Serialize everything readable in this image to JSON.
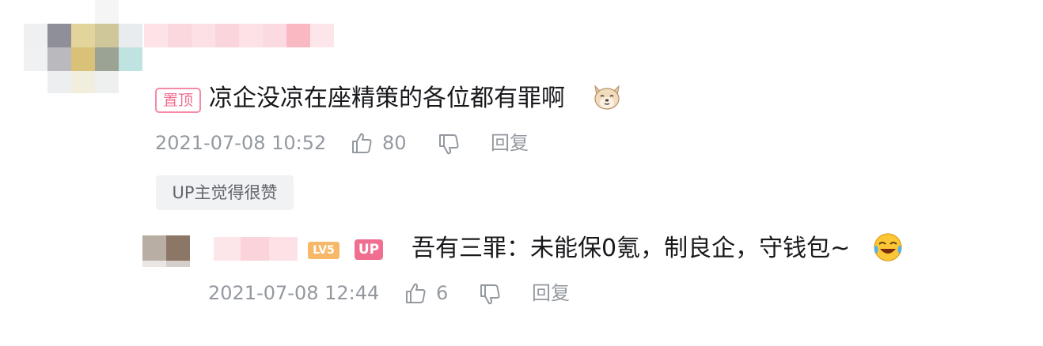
{
  "comment": {
    "pin_label": "置顶",
    "text": "凉企没凉在座精策的各位都有罪啊",
    "emoji_icon": "dog-face-emoji",
    "timestamp": "2021-07-08 10:52",
    "like_count": "80",
    "reply_label": "回复",
    "up_liked_tag": "UP主觉得很赞"
  },
  "reply": {
    "level_badge": "LV5",
    "up_badge": "UP",
    "text": "吾有三罪：未能保0氪，制良企，守钱包~",
    "emoji_icon": "laughing-crying-emoji",
    "timestamp": "2021-07-08 12:44",
    "like_count": "6",
    "reply_label": "回复"
  },
  "colors": {
    "accent_pink": "#f06f91",
    "muted_text": "#9499a0",
    "level_orange": "#f8b86a"
  }
}
